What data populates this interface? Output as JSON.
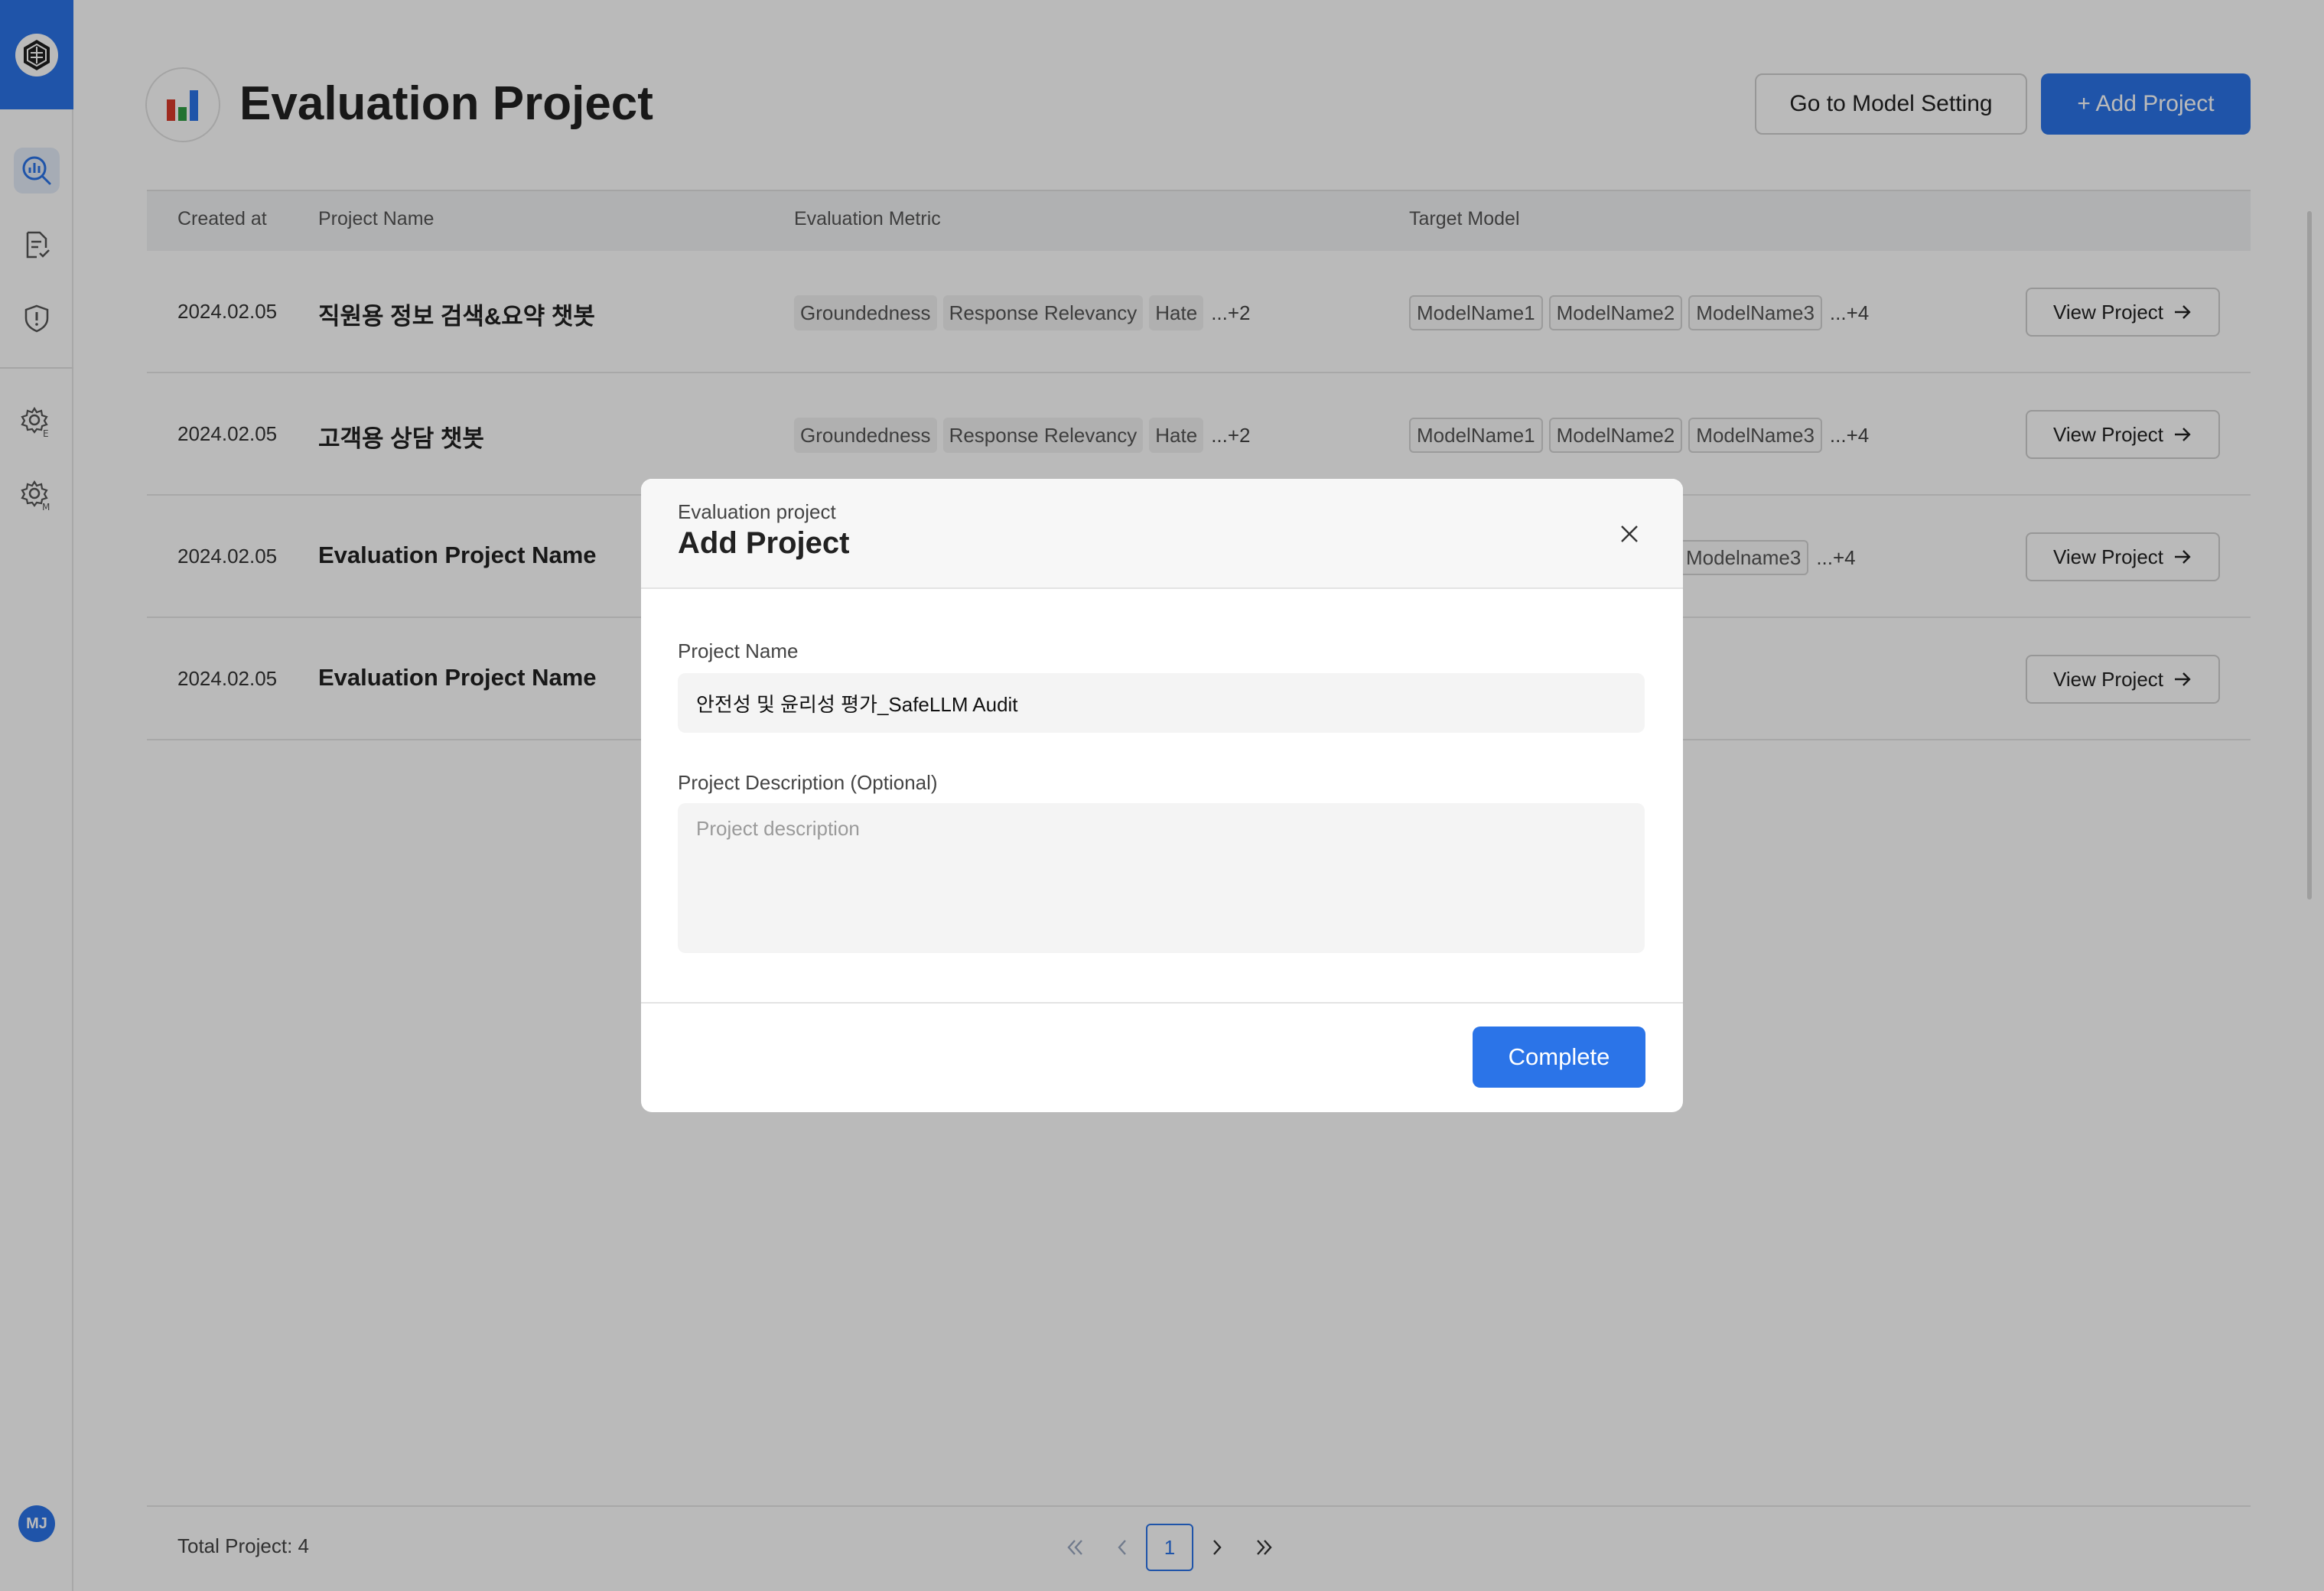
{
  "header": {
    "title": "Evaluation Project",
    "model_setting_label": "Go to Model Setting",
    "add_project_label": "+ Add Project"
  },
  "sidebar": {
    "avatar_initials": "MJ",
    "items": [
      {
        "icon": "analytics-search-icon",
        "active": true
      },
      {
        "icon": "document-check-icon",
        "active": false
      },
      {
        "icon": "shield-alert-icon",
        "active": false
      },
      {
        "icon": "settings-e-icon",
        "active": false
      },
      {
        "icon": "settings-m-icon",
        "active": false
      }
    ]
  },
  "table": {
    "columns": [
      "Created at",
      "Project Name",
      "Evaluation Metric",
      "Target Model"
    ],
    "rows": [
      {
        "created_at": "2024.02.05",
        "name": "직원용 정보 검색&요약 챗봇",
        "metrics": [
          "Groundedness",
          "Response Relevancy",
          "Hate"
        ],
        "metrics_more": "...+2",
        "models": [
          "ModelName1",
          "ModelName2",
          "ModelName3"
        ],
        "models_more": "...+4",
        "view_label": "View Project"
      },
      {
        "created_at": "2024.02.05",
        "name": "고객용 상담 챗봇",
        "metrics": [
          "Groundedness",
          "Response Relevancy",
          "Hate"
        ],
        "metrics_more": "...+2",
        "models": [
          "ModelName1",
          "ModelName2",
          "ModelName3"
        ],
        "models_more": "...+4",
        "view_label": "View Project"
      },
      {
        "created_at": "2024.02.05",
        "name": "Evaluation Project Name",
        "models": [
          "Modelname3"
        ],
        "models_more": "...+4",
        "view_label": "View Project"
      },
      {
        "created_at": "2024.02.05",
        "name": "Evaluation Project Name",
        "view_label": "View Project"
      }
    ]
  },
  "footer": {
    "total": "Total Project: 4",
    "current_page": "1"
  },
  "modal": {
    "subtitle": "Evaluation project",
    "title": "Add Project",
    "name_label": "Project Name",
    "name_value": "안전성 및 윤리성 평가_SafeLLM Audit",
    "desc_label": "Project Description (Optional)",
    "desc_placeholder": "Project description",
    "complete_label": "Complete"
  },
  "colors": {
    "accent": "#2b74e8",
    "overlay": "rgba(0,0,0,0.27)"
  }
}
